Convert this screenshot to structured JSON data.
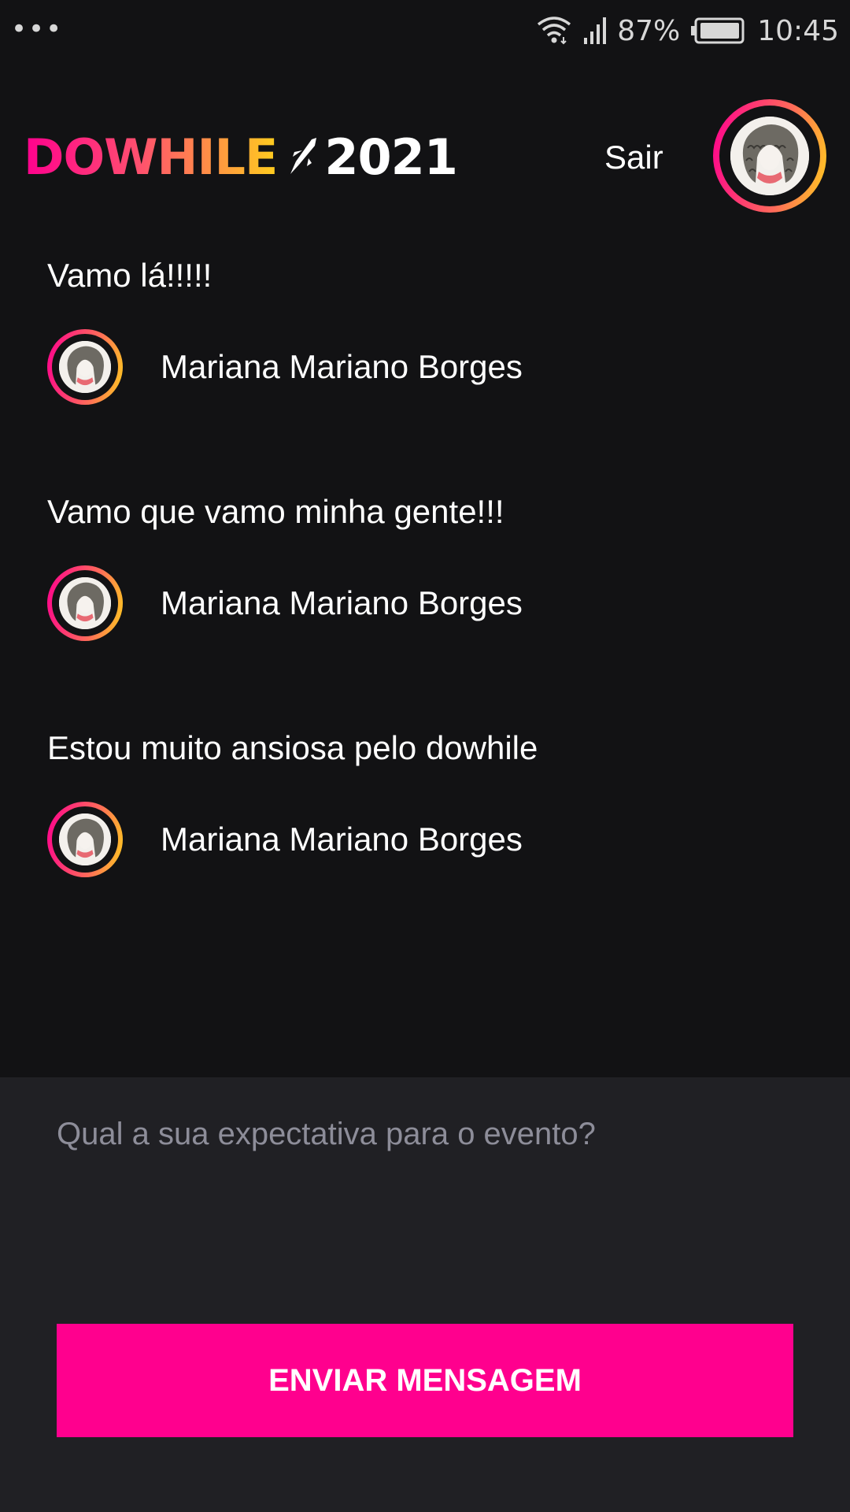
{
  "status_bar": {
    "dots": "•••",
    "battery_percent": "87%",
    "time": "10:45",
    "icons": [
      "wifi-icon",
      "signal-icon",
      "battery-icon"
    ]
  },
  "header": {
    "logo_word": "DOWHILE",
    "logo_year": "2021",
    "logout_label": "Sair",
    "avatar_icon": "user-avatar-curly-hair"
  },
  "messages": [
    {
      "text": "Vamo lá!!!!!",
      "user": "Mariana Mariano Borges"
    },
    {
      "text": "Vamo que vamo minha gente!!!",
      "user": "Mariana Mariano Borges"
    },
    {
      "text": "Estou muito ansiosa pelo dowhile",
      "user": "Mariana Mariano Borges"
    }
  ],
  "composer": {
    "placeholder": "Qual a sua expectativa para o evento?",
    "value": "",
    "send_label": "ENVIAR MENSAGEM"
  },
  "colors": {
    "background": "#121214",
    "composer_background": "#202024",
    "accent_pink": "#ff008e",
    "accent_yellow": "#ffcd1e",
    "placeholder": "#8d8d99"
  }
}
